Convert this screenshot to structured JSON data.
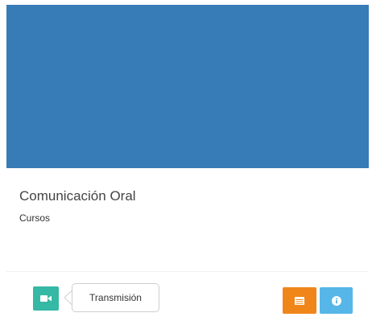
{
  "course": {
    "title": "Comunicación Oral",
    "category": "Cursos",
    "cover_color": "#377bb7"
  },
  "actions": {
    "video_icon": "video-camera-icon",
    "tooltip_label": "Transmisión",
    "table_icon": "table-icon",
    "info_icon": "info-icon"
  },
  "colors": {
    "video_button": "#35b8a4",
    "table_button": "#f0861a",
    "info_button": "#56b6e8"
  }
}
